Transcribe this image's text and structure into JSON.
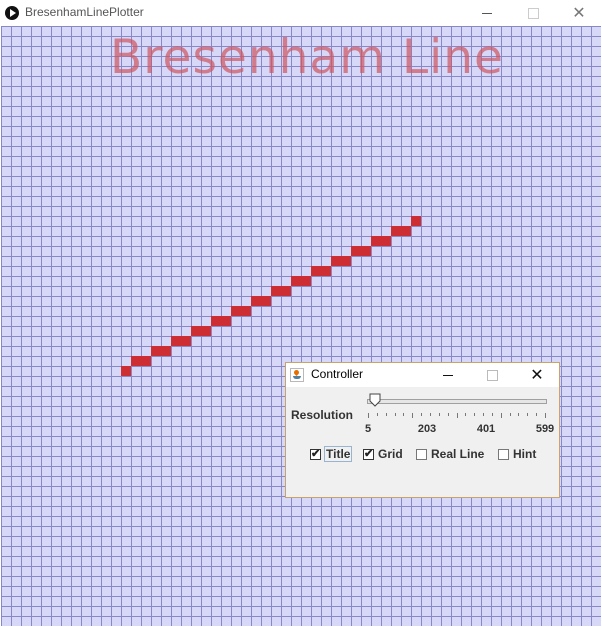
{
  "window": {
    "title": "BresenhamLinePlotter",
    "icon": "play-circle-icon"
  },
  "canvas": {
    "title_text": "Bresenham Line",
    "colors": {
      "background": "#d7d7f7",
      "grid": "#8888c8",
      "pixel": "#cc2e33",
      "title": "#cd555f"
    },
    "grid_cell_size": 10,
    "plotted_cells": [
      [
        12,
        34
      ],
      [
        13,
        33
      ],
      [
        14,
        33
      ],
      [
        15,
        32
      ],
      [
        16,
        32
      ],
      [
        17,
        31
      ],
      [
        18,
        31
      ],
      [
        19,
        30
      ],
      [
        20,
        30
      ],
      [
        21,
        29
      ],
      [
        22,
        29
      ],
      [
        23,
        28
      ],
      [
        24,
        28
      ],
      [
        25,
        27
      ],
      [
        26,
        27
      ],
      [
        27,
        26
      ],
      [
        28,
        26
      ],
      [
        29,
        25
      ],
      [
        30,
        25
      ],
      [
        31,
        24
      ],
      [
        32,
        24
      ],
      [
        33,
        23
      ],
      [
        34,
        23
      ],
      [
        35,
        22
      ],
      [
        36,
        22
      ],
      [
        37,
        21
      ],
      [
        38,
        21
      ],
      [
        39,
        20
      ],
      [
        40,
        20
      ],
      [
        41,
        19
      ]
    ]
  },
  "controller": {
    "title": "Controller",
    "resolution_label": "Resolution",
    "slider": {
      "min": 5,
      "max": 599,
      "value": 30,
      "major_labels": [
        "5",
        "203",
        "401",
        "599"
      ]
    },
    "checkboxes": [
      {
        "label": "Title",
        "checked": true,
        "focused": true
      },
      {
        "label": "Grid",
        "checked": true,
        "focused": false
      },
      {
        "label": "Real Line",
        "checked": false,
        "focused": false
      },
      {
        "label": "Hint",
        "checked": false,
        "focused": false
      }
    ]
  }
}
